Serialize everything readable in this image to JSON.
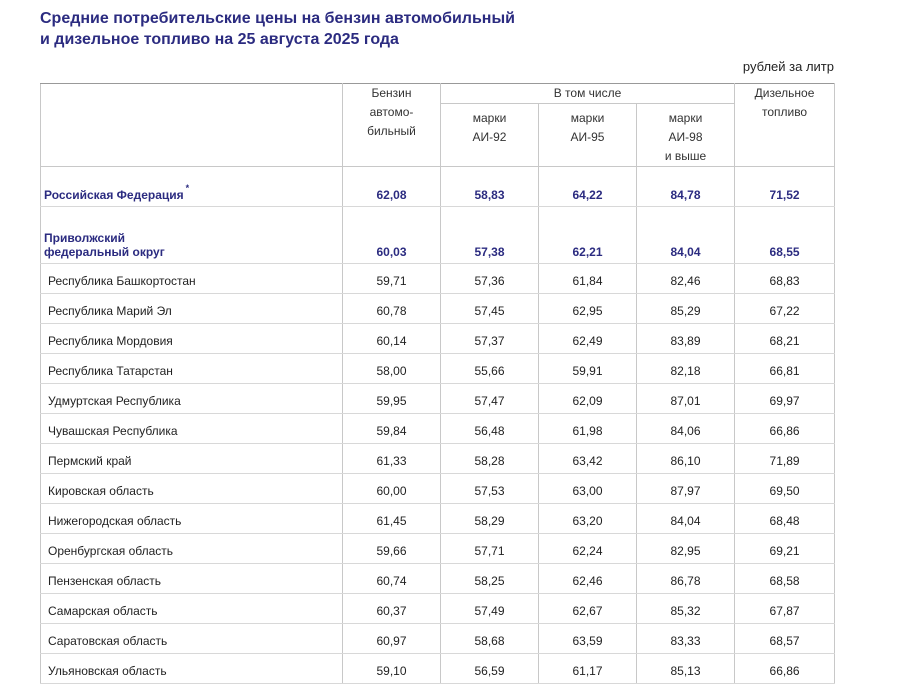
{
  "title": {
    "line1": "Средние потребительские цены на бензин автомобильный",
    "line2": "и дизельное топливо на 25 августа 2025 года"
  },
  "units": "рублей за литр",
  "headers": {
    "gasoline": [
      "Бензин",
      "автомо-",
      "бильный"
    ],
    "including": "В том числе",
    "ai92": [
      "марки",
      "АИ-92"
    ],
    "ai95": [
      "марки",
      "АИ-95"
    ],
    "ai98": [
      "марки",
      "АИ-98",
      "и выше"
    ],
    "diesel": [
      "Дизельное",
      "топливо"
    ]
  },
  "federation": {
    "name": "Российская Федерация",
    "note_mark": "*",
    "values": [
      "62,08",
      "58,83",
      "64,22",
      "84,78",
      "71,52"
    ]
  },
  "district": {
    "name_line1": "Приволжский",
    "name_line2": "федеральный округ",
    "values": [
      "60,03",
      "57,38",
      "62,21",
      "84,04",
      "68,55"
    ]
  },
  "regions": [
    {
      "name": "Республика Башкортостан",
      "values": [
        "59,71",
        "57,36",
        "61,84",
        "82,46",
        "68,83"
      ]
    },
    {
      "name": "Республика Марий Эл",
      "values": [
        "60,78",
        "57,45",
        "62,95",
        "85,29",
        "67,22"
      ]
    },
    {
      "name": "Республика Мордовия",
      "values": [
        "60,14",
        "57,37",
        "62,49",
        "83,89",
        "68,21"
      ]
    },
    {
      "name": "Республика Татарстан",
      "values": [
        "58,00",
        "55,66",
        "59,91",
        "82,18",
        "66,81"
      ]
    },
    {
      "name": "Удмуртская Республика",
      "values": [
        "59,95",
        "57,47",
        "62,09",
        "87,01",
        "69,97"
      ]
    },
    {
      "name": "Чувашская Республика",
      "values": [
        "59,84",
        "56,48",
        "61,98",
        "84,06",
        "66,86"
      ]
    },
    {
      "name": "Пермский край",
      "values": [
        "61,33",
        "58,28",
        "63,42",
        "86,10",
        "71,89"
      ]
    },
    {
      "name": "Кировская область",
      "values": [
        "60,00",
        "57,53",
        "63,00",
        "87,97",
        "69,50"
      ]
    },
    {
      "name": "Нижегородская область",
      "values": [
        "61,45",
        "58,29",
        "63,20",
        "84,04",
        "68,48"
      ]
    },
    {
      "name": "Оренбургская область",
      "values": [
        "59,66",
        "57,71",
        "62,24",
        "82,95",
        "69,21"
      ]
    },
    {
      "name": "Пензенская область",
      "values": [
        "60,74",
        "58,25",
        "62,46",
        "86,78",
        "68,58"
      ]
    },
    {
      "name": "Самарская область",
      "values": [
        "60,37",
        "57,49",
        "62,67",
        "85,32",
        "67,87"
      ]
    },
    {
      "name": "Саратовская область",
      "values": [
        "60,97",
        "58,68",
        "63,59",
        "83,33",
        "68,57"
      ]
    },
    {
      "name": "Ульяновская область",
      "values": [
        "59,10",
        "56,59",
        "61,17",
        "85,13",
        "66,86"
      ]
    }
  ]
}
